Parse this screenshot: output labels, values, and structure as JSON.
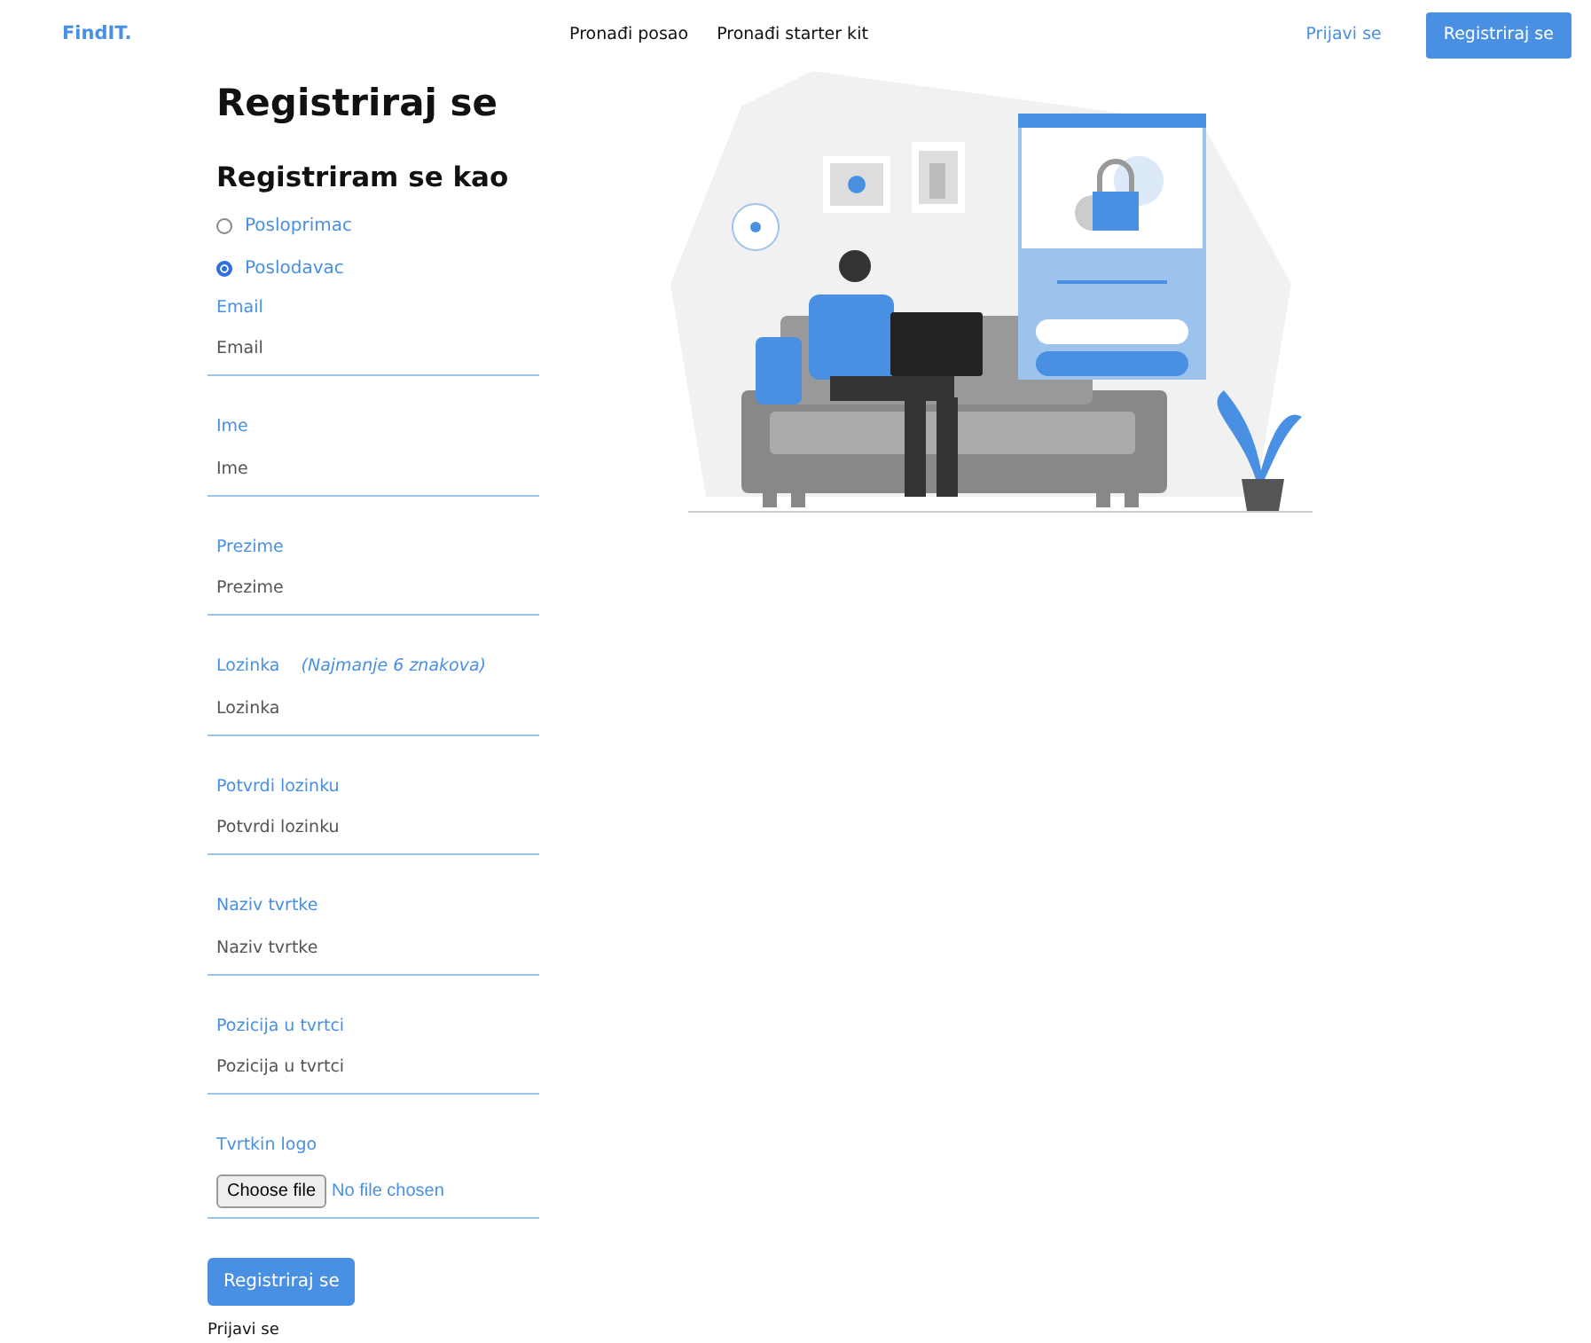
{
  "navbar": {
    "brand": "FindIT.",
    "links": [
      {
        "label": "Pronađi posao"
      },
      {
        "label": "Pronađi starter kit"
      }
    ],
    "login": "Prijavi se",
    "register": "Registriraj se"
  },
  "page_title": "Registriraj se",
  "role_heading": "Registriram se kao",
  "roles": [
    {
      "label": "Posloprimac",
      "selected": false
    },
    {
      "label": "Poslodavac",
      "selected": true
    }
  ],
  "fields": [
    {
      "kind": "text",
      "label": "Email",
      "placeholder": "Email"
    },
    {
      "kind": "text",
      "label": "Ime",
      "placeholder": "Ime"
    },
    {
      "kind": "text",
      "label": "Prezime",
      "placeholder": "Prezime"
    },
    {
      "kind": "text",
      "label": "Lozinka",
      "hint": "(Najmanje 6 znakova)",
      "placeholder": "Lozinka"
    },
    {
      "kind": "text",
      "label": "Potvrdi lozinku",
      "placeholder": "Potvrdi lozinku"
    },
    {
      "kind": "text",
      "label": "Naziv tvrtke",
      "placeholder": "Naziv tvrtke"
    },
    {
      "kind": "text",
      "label": "Pozicija u tvrtci",
      "placeholder": "Pozicija u tvrtci"
    },
    {
      "kind": "file",
      "label": "Tvrtkin logo",
      "button": "Choose file",
      "status": "No file chosen"
    }
  ],
  "submit": "Registriraj se",
  "login_link": "Prijavi se"
}
